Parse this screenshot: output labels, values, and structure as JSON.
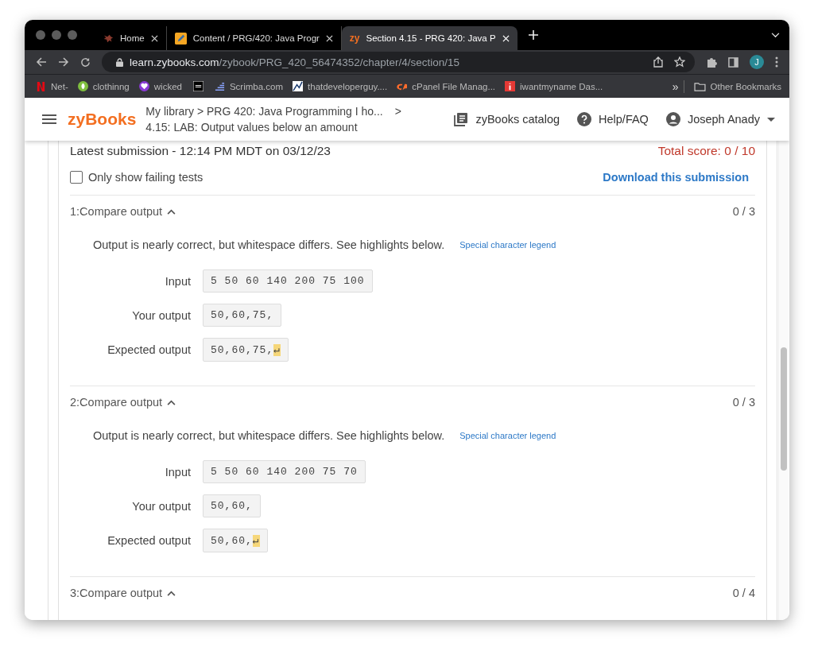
{
  "browser": {
    "tabs": [
      {
        "title": "Home",
        "selected": false
      },
      {
        "title": "Content / PRG/420: Java Progr",
        "selected": false
      },
      {
        "title": "Section 4.15 - PRG 420: Java P",
        "favicon_text": "zy",
        "selected": true
      }
    ],
    "url_host": "learn.zybooks.com",
    "url_path": "/zybook/PRG_420_56474352/chapter/4/section/15",
    "profile_initial": "J",
    "bookmarks": [
      {
        "label": "Net-"
      },
      {
        "label": "clothinng"
      },
      {
        "label": "wicked"
      },
      {
        "kind": "icon_only"
      },
      {
        "label": "Scrimba.com"
      },
      {
        "label": "thatdeveloperguy...."
      },
      {
        "label": "cPanel File Manag..."
      },
      {
        "label": "iwantmyname Das..."
      }
    ],
    "more": "»",
    "other_bookmarks": "Other Bookmarks"
  },
  "header": {
    "logo": "zyBooks",
    "breadcrumb_line1": "My library > PRG 420: Java Programming I ho...",
    "breadcrumb_sep": ">",
    "breadcrumb_line2": "4.15: LAB: Output values below an amount",
    "catalog": "zyBooks catalog",
    "help": "Help/FAQ",
    "user": "Joseph Anady"
  },
  "submission": {
    "latest": "Latest submission - 12:14 PM MDT on 03/12/23",
    "total_score": "Total score: 0 / 10",
    "filter_label": "Only show failing tests",
    "filter_checked": false,
    "download": "Download this submission"
  },
  "tests": [
    {
      "title": "1:Compare output",
      "score": "0 / 3",
      "expanded": true,
      "message": "Output is nearly correct, but whitespace differs. See highlights below.",
      "legend": "Special character legend",
      "rows": [
        {
          "label": "Input",
          "value": "5 50 60 140 200 75 100"
        },
        {
          "label": "Your output",
          "value": "50,60,75,"
        },
        {
          "label": "Expected output",
          "value": "50,60,75,",
          "highlight": "↵"
        }
      ]
    },
    {
      "title": "2:Compare output",
      "score": "0 / 3",
      "expanded": true,
      "message": "Output is nearly correct, but whitespace differs. See highlights below.",
      "legend": "Special character legend",
      "rows": [
        {
          "label": "Input",
          "value": "5 50 60 140 200 75 70"
        },
        {
          "label": "Your output",
          "value": "50,60,"
        },
        {
          "label": "Expected output",
          "value": "50,60,",
          "highlight": "↵"
        }
      ]
    },
    {
      "title": "3:Compare output",
      "score": "0 / 4",
      "expanded": true
    }
  ]
}
